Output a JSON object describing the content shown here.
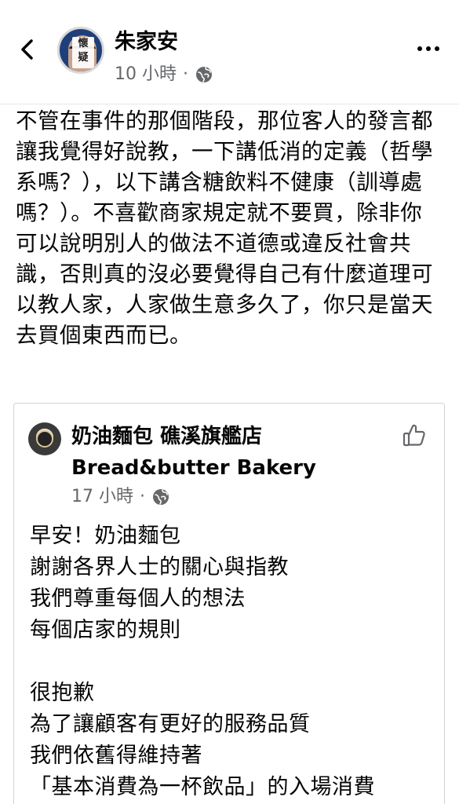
{
  "header": {
    "author_name": "朱家安",
    "avatar_badge": "懷\n疑",
    "timestamp": "10 小時",
    "dot": "·",
    "icons": {
      "back": "chevron-left-icon",
      "audience": "globe-icon",
      "more": "more-horizontal-icon"
    }
  },
  "post": {
    "text": "不管在事件的那個階段，那位客人的發言都讓我覺得好說教，一下講低消的定義（哲學系嗎？），以下講含糖飲料不健康（訓導處嗎？）。不喜歡商家規定就不要買，除非你可以說明別人的做法不道德或違反社會共識，否則真的沒必要覺得自己有什麼道理可以教人家，人家做生意多久了，你只是當天去買個東西而已。"
  },
  "shared": {
    "name": "奶油麵包 礁溪旗艦店 Bread&butter Bakery",
    "timestamp": "17 小時",
    "dot": "·",
    "text": "早安！奶油麵包\n謝謝各界人士的關心與指教\n我們尊重每個人的想法\n每個店家的規則\n\n很抱歉\n為了讓顧客有更好的服務品質\n我們依舊得維持著\n「基本消費為一杯飲品」的入場消費",
    "icons": {
      "like": "thumbs-up-icon",
      "audience": "globe-icon"
    }
  },
  "colors": {
    "text": "#050505",
    "secondary": "#65676b",
    "border": "#d0d2d6"
  }
}
